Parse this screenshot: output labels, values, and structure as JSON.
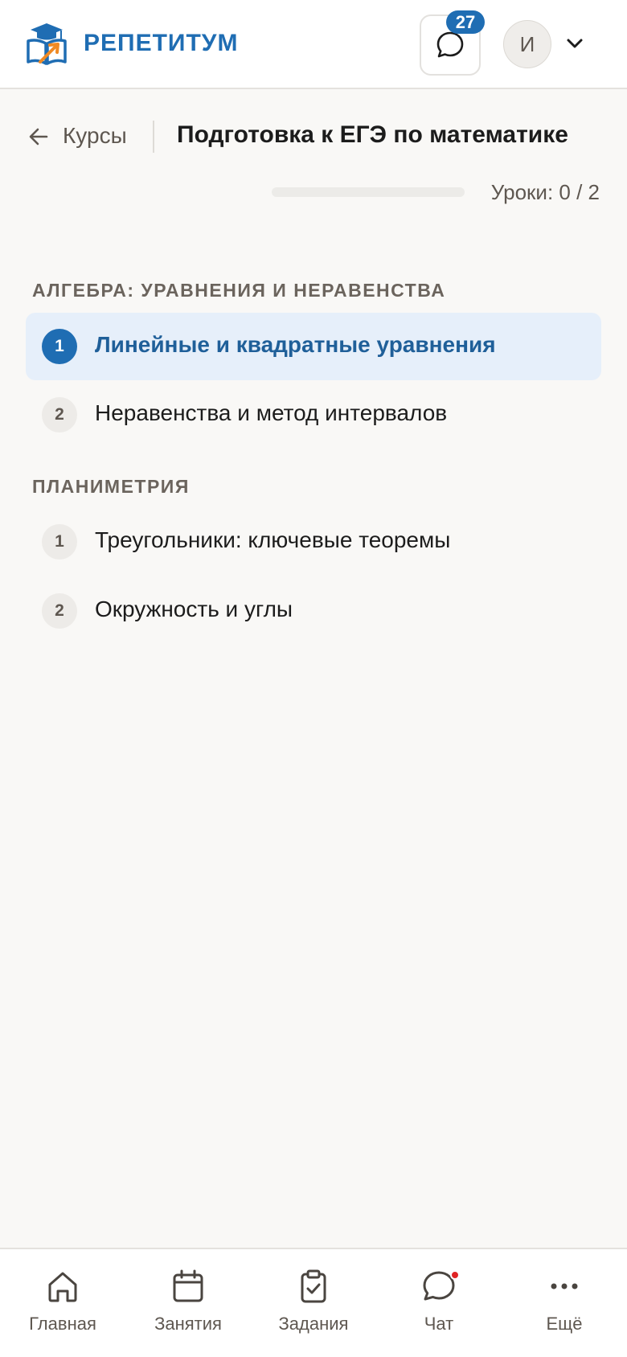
{
  "header": {
    "brand": "РЕПЕТИТУМ",
    "chat_badge": "27",
    "avatar_initial": "И",
    "brand_color": "#1f6db3"
  },
  "breadcrumb": {
    "back_label": "Курсы",
    "title": "Подготовка к ЕГЭ по математике"
  },
  "progress": {
    "text": "Уроки: 0 / 2",
    "completed": 0,
    "total": 2
  },
  "sections": [
    {
      "title": "АЛГЕБРА: УРАВНЕНИЯ И НЕРАВЕНСТВА",
      "lessons": [
        {
          "num": "1",
          "title": "Линейные и квадратные уравнения",
          "active": true
        },
        {
          "num": "2",
          "title": "Неравенства и метод интервалов",
          "active": false
        }
      ]
    },
    {
      "title": "ПЛАНИМЕТРИЯ",
      "lessons": [
        {
          "num": "1",
          "title": "Треугольники: ключевые теоремы",
          "active": false
        },
        {
          "num": "2",
          "title": "Окружность и углы",
          "active": false
        }
      ]
    }
  ],
  "bottom_nav": [
    {
      "label": "Главная",
      "icon": "home-icon"
    },
    {
      "label": "Занятия",
      "icon": "calendar-icon"
    },
    {
      "label": "Задания",
      "icon": "clipboard-check-icon"
    },
    {
      "label": "Чат",
      "icon": "chat-icon",
      "has_dot": true
    },
    {
      "label": "Ещё",
      "icon": "more-icon"
    }
  ]
}
